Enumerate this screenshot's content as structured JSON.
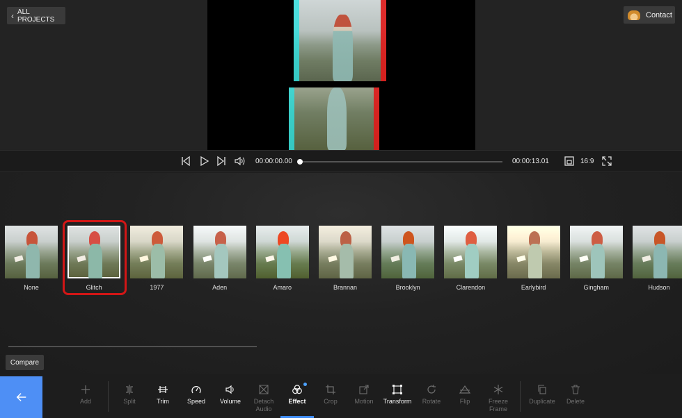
{
  "header": {
    "all_projects_label": "ALL PROJECTS",
    "contact_label": "Contact"
  },
  "playbar": {
    "current_time": "00:00:00.00",
    "total_time": "00:00:13.01",
    "aspect_ratio": "16:9",
    "progress": 0
  },
  "effects": [
    {
      "label": "None"
    },
    {
      "label": "Glitch"
    },
    {
      "label": "1977"
    },
    {
      "label": "Aden"
    },
    {
      "label": "Amaro"
    },
    {
      "label": "Brannan"
    },
    {
      "label": "Brooklyn"
    },
    {
      "label": "Clarendon"
    },
    {
      "label": "Earlybird"
    },
    {
      "label": "Gingham"
    },
    {
      "label": "Hudson"
    }
  ],
  "selected_effect": "Glitch",
  "compare_label": "Compare",
  "toolbar": {
    "add": "Add",
    "split": "Split",
    "trim": "Trim",
    "speed": "Speed",
    "volume": "Volume",
    "detach_audio_1": "Detach",
    "detach_audio_2": "Audio",
    "effect": "Effect",
    "crop": "Crop",
    "motion": "Motion",
    "transform": "Transform",
    "rotate": "Rotate",
    "flip": "Flip",
    "freeze_frame_1": "Freeze",
    "freeze_frame_2": "Frame",
    "duplicate": "Duplicate",
    "delete": "Delete"
  },
  "colors": {
    "accent": "#4e8ff5",
    "highlight": "#d21616",
    "background": "#1e1e1e"
  }
}
